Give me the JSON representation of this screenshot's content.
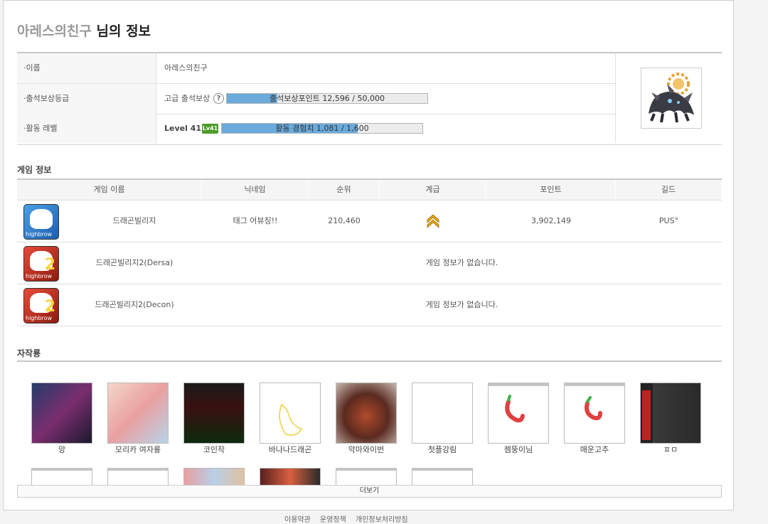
{
  "page_title": {
    "nickname": "아레스의친구",
    "suffix": " 님의 정보"
  },
  "profile": {
    "rows": [
      {
        "label": "·이름",
        "value": "아레스의친구"
      },
      {
        "label": "·출석보상등급",
        "value": "고급 출석보상",
        "help": "?",
        "bar_text": "출석보상포인트 12,596 / 50,000",
        "bar_progress": 0.252
      },
      {
        "label": "·활동 레벨",
        "value": "Level 41",
        "badge": "Lv41",
        "bar_text": "활동 경험치 1,081 / 1,600",
        "bar_progress": 0.676
      }
    ]
  },
  "game_info": {
    "title": "게임 정보",
    "columns": [
      "게임 이름",
      "닉네임",
      "순위",
      "계급",
      "포인트",
      "길드"
    ],
    "rows": [
      {
        "name": "드래곤빌리지",
        "nickname": "태그 어뷰징!!",
        "rank": "210,460",
        "point": "3,902,149",
        "guild": "PUS°",
        "icon_color": "blue",
        "icon_num": "",
        "brand": "highbrow"
      },
      {
        "name": "드래곤빌리지2(Dersa)",
        "empty": "게임 정보가 없습니다.",
        "icon_color": "red",
        "icon_num": "2",
        "brand": "highbrow"
      },
      {
        "name": "드래곤빌리지2(Decon)",
        "empty": "게임 정보가 없습니다.",
        "icon_color": "red",
        "icon_num": "2",
        "brand": "highbrow"
      }
    ]
  },
  "works": {
    "title": "자작룡",
    "items": [
      "앙",
      "모리카 여자룡",
      "코인작",
      "바나나드래곤",
      "악마와이번",
      "첫플강림",
      "젬뚱이님",
      "매운고추",
      "ㅍㅁ"
    ],
    "more_label": "더보기"
  },
  "footer": {
    "links": [
      "이용약관",
      "운영정책",
      "개인정보처리방침"
    ]
  },
  "colors": {
    "bar_fill": "#6aabdc",
    "badge": "#4c9c2a",
    "rank_icon": "#e0a411"
  }
}
